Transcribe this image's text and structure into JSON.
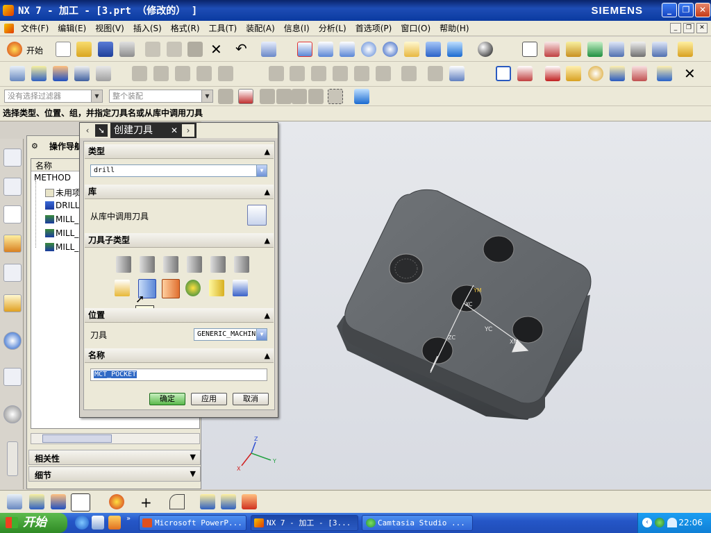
{
  "window": {
    "title": "NX 7 - 加工 - [3.prt （修改的） ]",
    "brand": "SIEMENS"
  },
  "menu": [
    "文件(F)",
    "编辑(E)",
    "视图(V)",
    "插入(S)",
    "格式(R)",
    "工具(T)",
    "装配(A)",
    "信息(I)",
    "分析(L)",
    "首选项(P)",
    "窗口(O)",
    "帮助(H)"
  ],
  "toolbar": {
    "start_label": "开始"
  },
  "filter": {
    "selection_filter": "没有选择过滤器",
    "assembly_scope": "整个装配"
  },
  "prompt": "选择类型、位置、组，并指定刀具名或从库中调用刀具",
  "navigator": {
    "title": "操作导航",
    "column_name": "名称",
    "root": "METHOD",
    "items": [
      "未用项",
      "DRILL",
      "MILL_",
      "MILL_",
      "MILL_"
    ],
    "relations": "相关性",
    "details": "细节"
  },
  "dialog": {
    "title": "创建刀具",
    "sections": {
      "type": "类型",
      "library": "库",
      "subtype": "刀具子类型",
      "location": "位置",
      "name": "名称"
    },
    "type_value": "drill",
    "library_label": "从库中调用刀具",
    "tool_label": "刀具",
    "tool_value": "GENERIC_MACHIN",
    "name_value": "MCT_POCKET",
    "tooltip": "TAP",
    "ok": "确定",
    "apply": "应用",
    "cancel": "取消"
  },
  "viewport": {
    "csys_labels": [
      "YM",
      "XC",
      "YC",
      "ZC",
      "XM"
    ],
    "triad": {
      "z": "Z",
      "y": "Y",
      "x": "X"
    }
  },
  "taskbar": {
    "start": "开始",
    "tasks": [
      "Microsoft PowerP...",
      "NX 7 - 加工 - [3...",
      "Camtasia Studio ..."
    ],
    "time": "22:06"
  }
}
